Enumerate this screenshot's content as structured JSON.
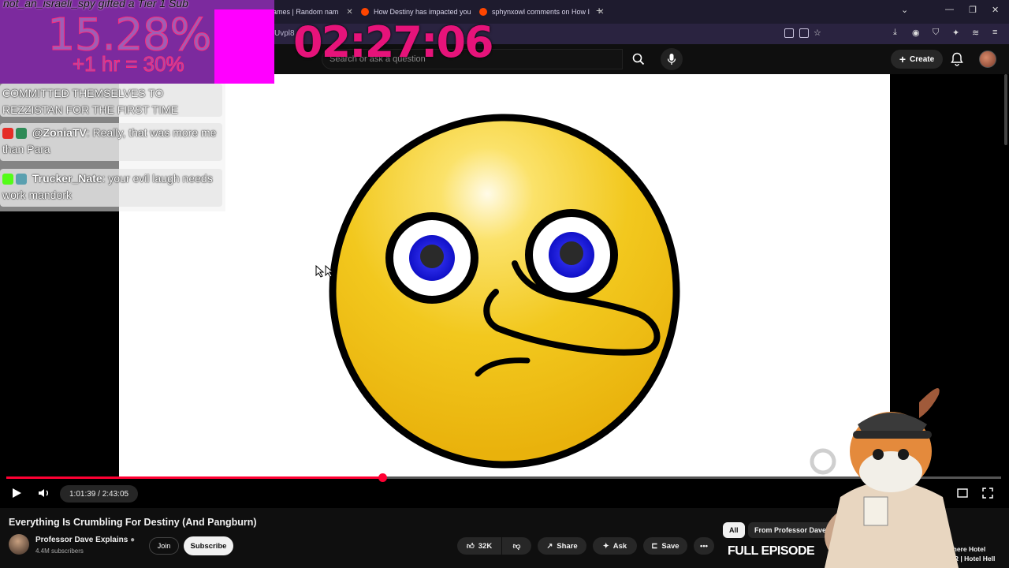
{
  "browser": {
    "tabs": [
      {
        "label": "...of Names | Random nam"
      },
      {
        "label": "How Destiny has impacted you"
      },
      {
        "label": "sphynxowl comments on How I"
      }
    ],
    "url_fragment": "Uvpl8"
  },
  "overlay": {
    "gift_text": "not_an_israeli_spy gifted a Tier 1 Sub",
    "percent": "15.28%",
    "bonus": "+1 hr = 30%",
    "timer": "02:27:06",
    "chat": [
      {
        "user": "",
        "text": "COMMITTED THEMSELVES TO REZZISTAN FOR THE FIRST TIME"
      },
      {
        "user": "@ZoniaTV",
        "text": "Really, that was more me than Para"
      },
      {
        "user": "Trucker_Nate",
        "text": "your evil laugh needs work mandork"
      }
    ]
  },
  "header": {
    "search_placeholder": "Search or ask a question",
    "create_label": "Create"
  },
  "player": {
    "time_current": "1:01:39",
    "time_total": "2:43:05",
    "time_display": "1:01:39 / 2:43:05",
    "progress_fraction": 0.378
  },
  "video": {
    "title": "Everything Is Crumbling For Destiny (And Pangburn)",
    "channel": "Professor Dave Explains",
    "subscribers": "4.4M subscribers",
    "join_label": "Join",
    "subscribe_label": "Subscribe",
    "likes": "32K",
    "share_label": "Share",
    "ask_label": "Ask",
    "save_label": "Save"
  },
  "sidebar": {
    "chips": [
      {
        "label": "All"
      },
      {
        "label": "From Professor Dave E..."
      }
    ],
    "thumb_text": "FULL EPISODE",
    "next_title": "The Infamous Where Hotel BOILS A BURGER | Hotel Hell"
  },
  "colors": {
    "accent": "#ff0033",
    "timer": "#e6137a",
    "overlay_purple": "#7c2a9e",
    "overlay_magenta": "#ff00ff"
  }
}
